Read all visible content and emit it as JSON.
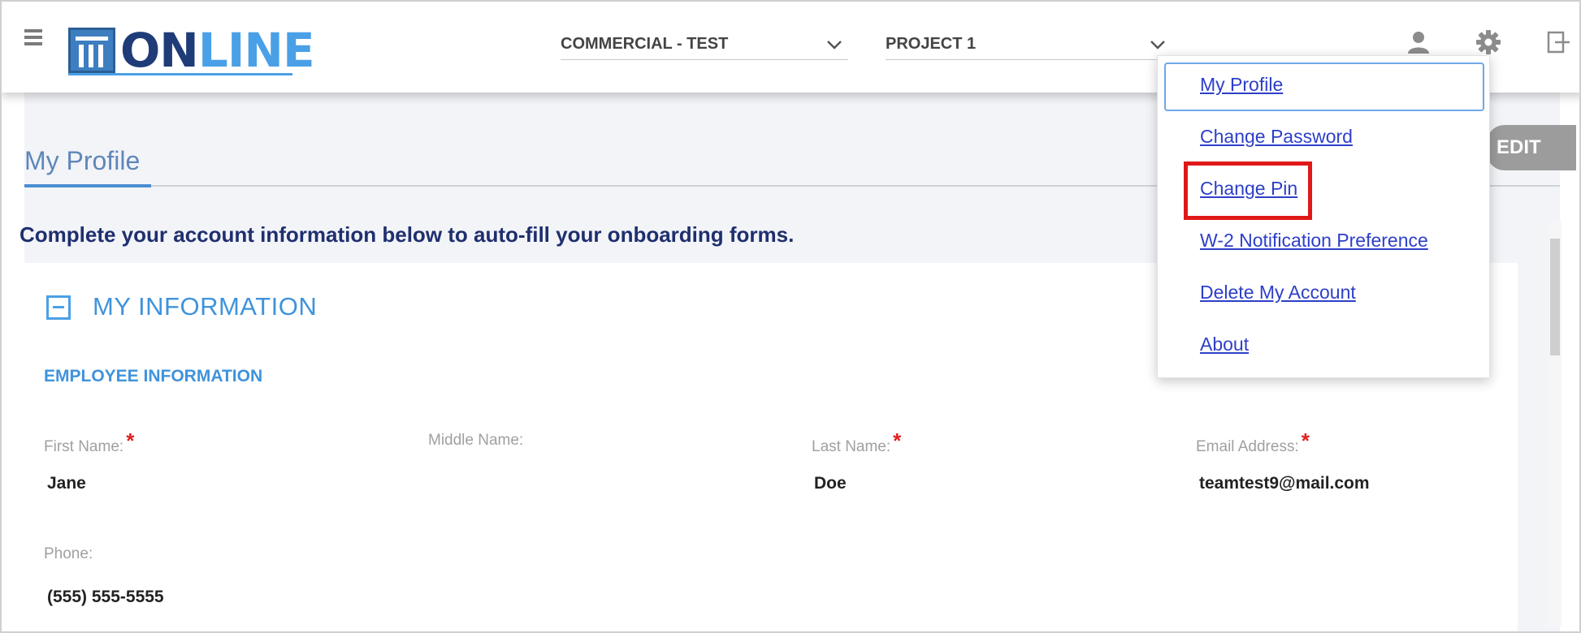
{
  "header": {
    "logo_text_on": "ON",
    "logo_text_line": "LINE",
    "company_selector": "COMMERCIAL - TEST",
    "project_selector": "PROJECT 1"
  },
  "page": {
    "tab_label": "My Profile",
    "edit_label": "EDIT",
    "intro_text": "Complete your account information below to auto-fill your onboarding forms.",
    "section_title": "MY INFORMATION",
    "subsection_title": "EMPLOYEE INFORMATION",
    "fields": {
      "first_name": {
        "label": "First Name:",
        "value": "Jane",
        "required": "*"
      },
      "middle_name": {
        "label": "Middle Name:",
        "value": ""
      },
      "last_name": {
        "label": "Last Name:",
        "value": "Doe",
        "required": "*"
      },
      "email": {
        "label": "Email Address:",
        "value": "teamtest9@mail.com",
        "required": "*"
      },
      "phone": {
        "label": "Phone:",
        "value": "(555) 555-5555"
      }
    }
  },
  "profile_menu": {
    "items": [
      {
        "label": "My Profile"
      },
      {
        "label": "Change Password"
      },
      {
        "label": "Change Pin"
      },
      {
        "label": "W-2 Notification Preference"
      },
      {
        "label": "Delete My Account"
      },
      {
        "label": "About"
      }
    ],
    "highlighted_item": "Change Pin"
  },
  "colors": {
    "brand_dark": "#1f3c78",
    "brand_light": "#4aa0e6",
    "link": "#2d3fc8",
    "required": "#e02020",
    "highlight": "#e01818"
  }
}
